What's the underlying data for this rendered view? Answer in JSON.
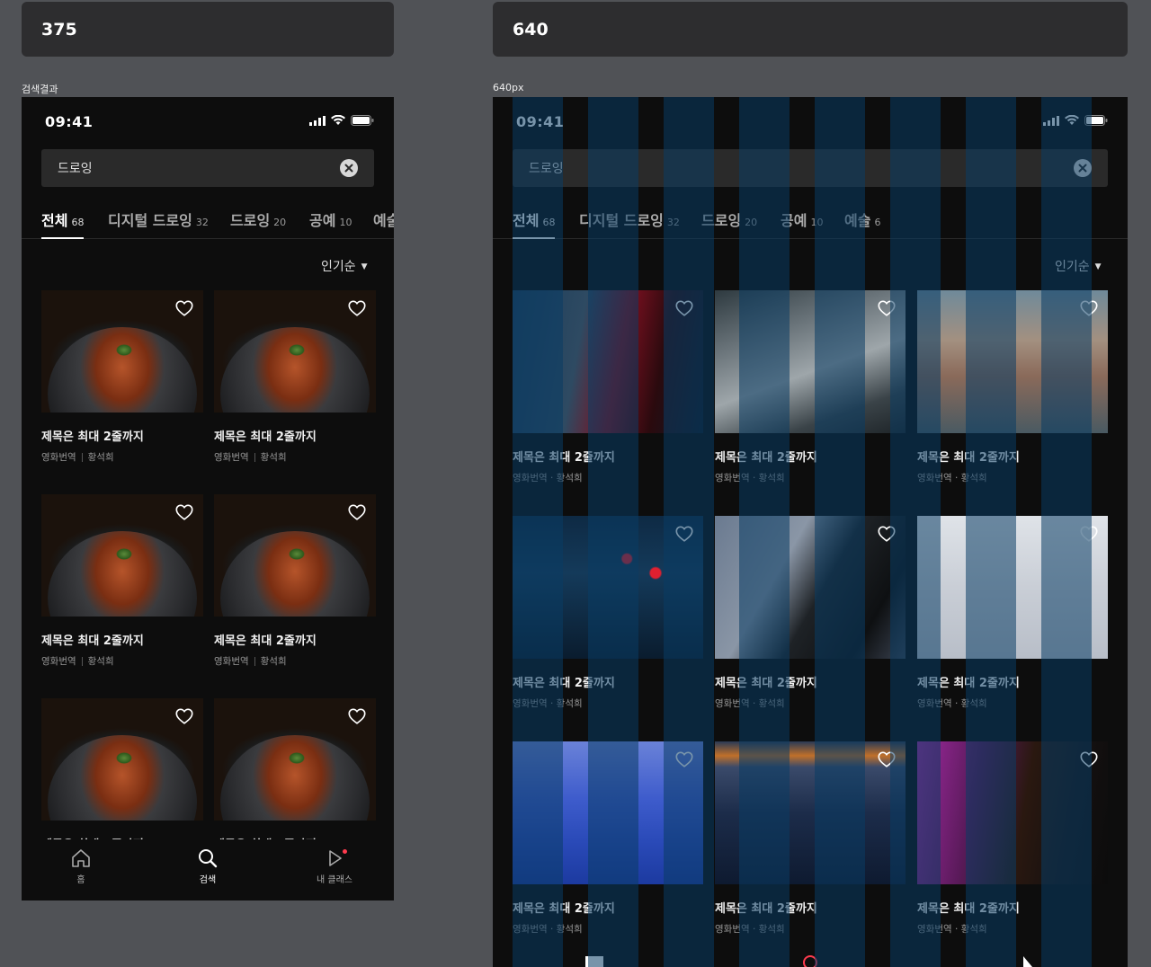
{
  "frames": [
    {
      "header": "375",
      "label": "검색결과"
    },
    {
      "header": "640",
      "label": "640px"
    }
  ],
  "status": {
    "time": "09:41"
  },
  "search": {
    "query": "드로잉"
  },
  "tabs": [
    {
      "label": "전체",
      "count": "68"
    },
    {
      "label": "디지털 드로잉",
      "count": "32"
    },
    {
      "label": "드로잉",
      "count": "20"
    },
    {
      "label": "공예",
      "count": "10"
    },
    {
      "label": "예술",
      "count": "6"
    }
  ],
  "tabs_clipped": {
    "label": "예술"
  },
  "sort": {
    "label": "인기순"
  },
  "card": {
    "title": "제목은 최대 2줄까지",
    "category": "영화번역",
    "author": "황석희",
    "meta_dot": "영화번역 · 황석희"
  },
  "card_clipped": {
    "title": "제목은 최대 2줄까지"
  },
  "bottom_nav": [
    {
      "label": "홈",
      "icon": "home-icon"
    },
    {
      "label": "검색",
      "icon": "search-icon"
    },
    {
      "label": "내 클래스",
      "icon": "play-icon"
    }
  ],
  "colors": {
    "accent": "#ff3b4e",
    "background": "#0d0d0d",
    "overlay": "#0a3c64"
  }
}
